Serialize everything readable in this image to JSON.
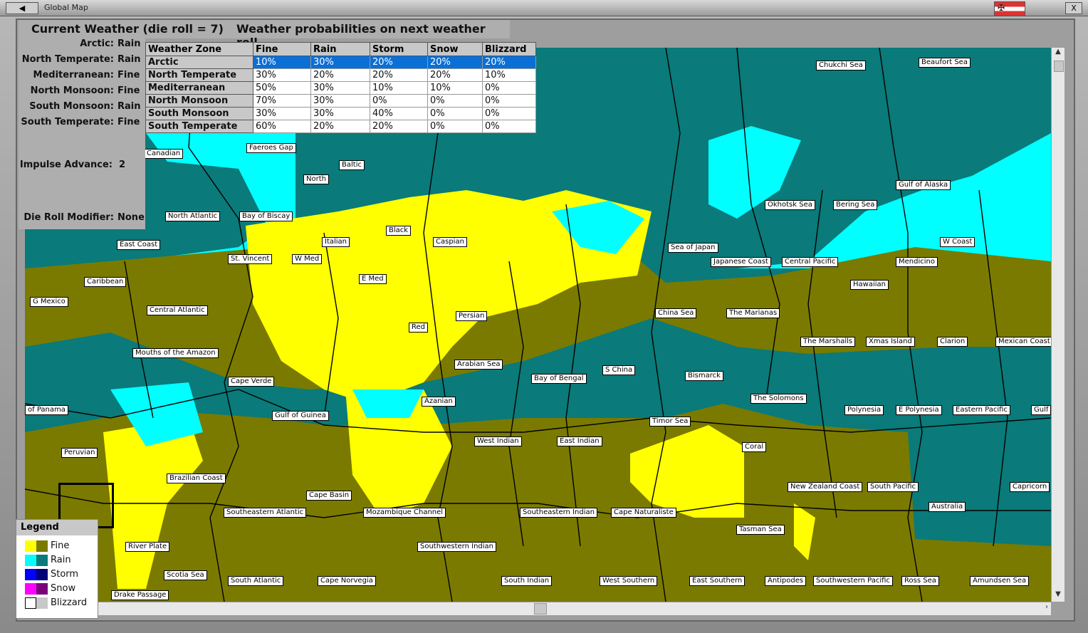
{
  "window": {
    "title": "Global Map",
    "close_label": "X",
    "menu_label": "◀"
  },
  "header": {
    "current_weather": "Current Weather (die roll = 7)",
    "probabilities": "Weather probabilities on next weather roll"
  },
  "current": [
    {
      "zone": "Arctic:",
      "value": "Rain"
    },
    {
      "zone": "North Temperate:",
      "value": "Rain"
    },
    {
      "zone": "Mediterranean:",
      "value": "Fine"
    },
    {
      "zone": "North Monsoon:",
      "value": "Fine"
    },
    {
      "zone": "South Monsoon:",
      "value": "Rain"
    },
    {
      "zone": "South Temperate:",
      "value": "Fine"
    }
  ],
  "impulse": {
    "label": "Impulse Advance:",
    "value": "2"
  },
  "modifier": {
    "label": "Die Roll Modifier:",
    "value": "None"
  },
  "table": {
    "headers": [
      "Weather Zone",
      "Fine",
      "Rain",
      "Storm",
      "Snow",
      "Blizzard"
    ],
    "rows": [
      [
        "Arctic",
        "10%",
        "30%",
        "20%",
        "20%",
        "20%"
      ],
      [
        "North Temperate",
        "30%",
        "20%",
        "20%",
        "20%",
        "10%"
      ],
      [
        "Mediterranean",
        "50%",
        "30%",
        "10%",
        "10%",
        "0%"
      ],
      [
        "North Monsoon",
        "70%",
        "30%",
        "0%",
        "0%",
        "0%"
      ],
      [
        "South Monsoon",
        "30%",
        "30%",
        "40%",
        "0%",
        "0%"
      ],
      [
        "South Temperate",
        "60%",
        "20%",
        "20%",
        "0%",
        "0%"
      ]
    ],
    "selected_row": 0
  },
  "legend": {
    "title": "Legend",
    "items": [
      {
        "label": "Fine",
        "c1": "#ffff00",
        "c2": "#7a7a00"
      },
      {
        "label": "Rain",
        "c1": "#00ffff",
        "c2": "#0a7a7a"
      },
      {
        "label": "Storm",
        "c1": "#0000ff",
        "c2": "#00007a"
      },
      {
        "label": "Snow",
        "c1": "#ff00ff",
        "c2": "#7a007a"
      },
      {
        "label": "Blizzard",
        "c1": "#ffffff",
        "c2": "#c8c8c8"
      }
    ]
  },
  "sea_labels": [
    "Chukchi Sea",
    "Beaufort Sea",
    "Canadian",
    "Faeroes Gap",
    "Baltic",
    "North",
    "Gulf of Alaska",
    "Okhotsk Sea",
    "Bering Sea",
    "North Atlantic",
    "Bay of Biscay",
    "Black",
    "Italian",
    "Caspian",
    "W Coast",
    "Sea of Japan",
    "East Coast",
    "St. Vincent",
    "W Med",
    "Japanese Coast",
    "Central Pacific",
    "Mendicino",
    "E Med",
    "Caribbean",
    "Hawaiian",
    "G Mexico",
    "Central Atlantic",
    "China Sea",
    "The Marianas",
    "Persian",
    "Red",
    "The Marshalls",
    "Xmas Island",
    "Clarion",
    "Mexican Coast",
    "Mouths of the Amazon",
    "Arabian Sea",
    "S China",
    "Bismarck",
    "Cape Verde",
    "Bay of Bengal",
    "The Solomons",
    "Azanian",
    "of Panama",
    "Gulf of Guinea",
    "Polynesia",
    "E Polynesia",
    "Eastern Pacific",
    "Gulf",
    "Timor Sea",
    "West Indian",
    "East Indian",
    "Peruvian",
    "Coral",
    "Brazilian Coast",
    "New Zealand Coast",
    "South Pacific",
    "Capricorn",
    "Cape Basin",
    "Australia",
    "Southeastern Atlantic",
    "Mozambique Channel",
    "Southeastern Indian",
    "Cape Naturaliste",
    "Tasman Sea",
    "River Plate",
    "Southwestern Indian",
    "Scotia Sea",
    "South Atlantic",
    "Cape Norvegia",
    "South Indian",
    "West Southern",
    "East Southern",
    "Antipodes",
    "Southwestern Pacific",
    "Ross Sea",
    "Amundsen Sea",
    "Drake Passage"
  ],
  "colors": {
    "fine_light": "#ffff00",
    "fine_dark": "#7a7a00",
    "rain_light": "#00ffff",
    "rain_dark": "#0a7a7a"
  }
}
